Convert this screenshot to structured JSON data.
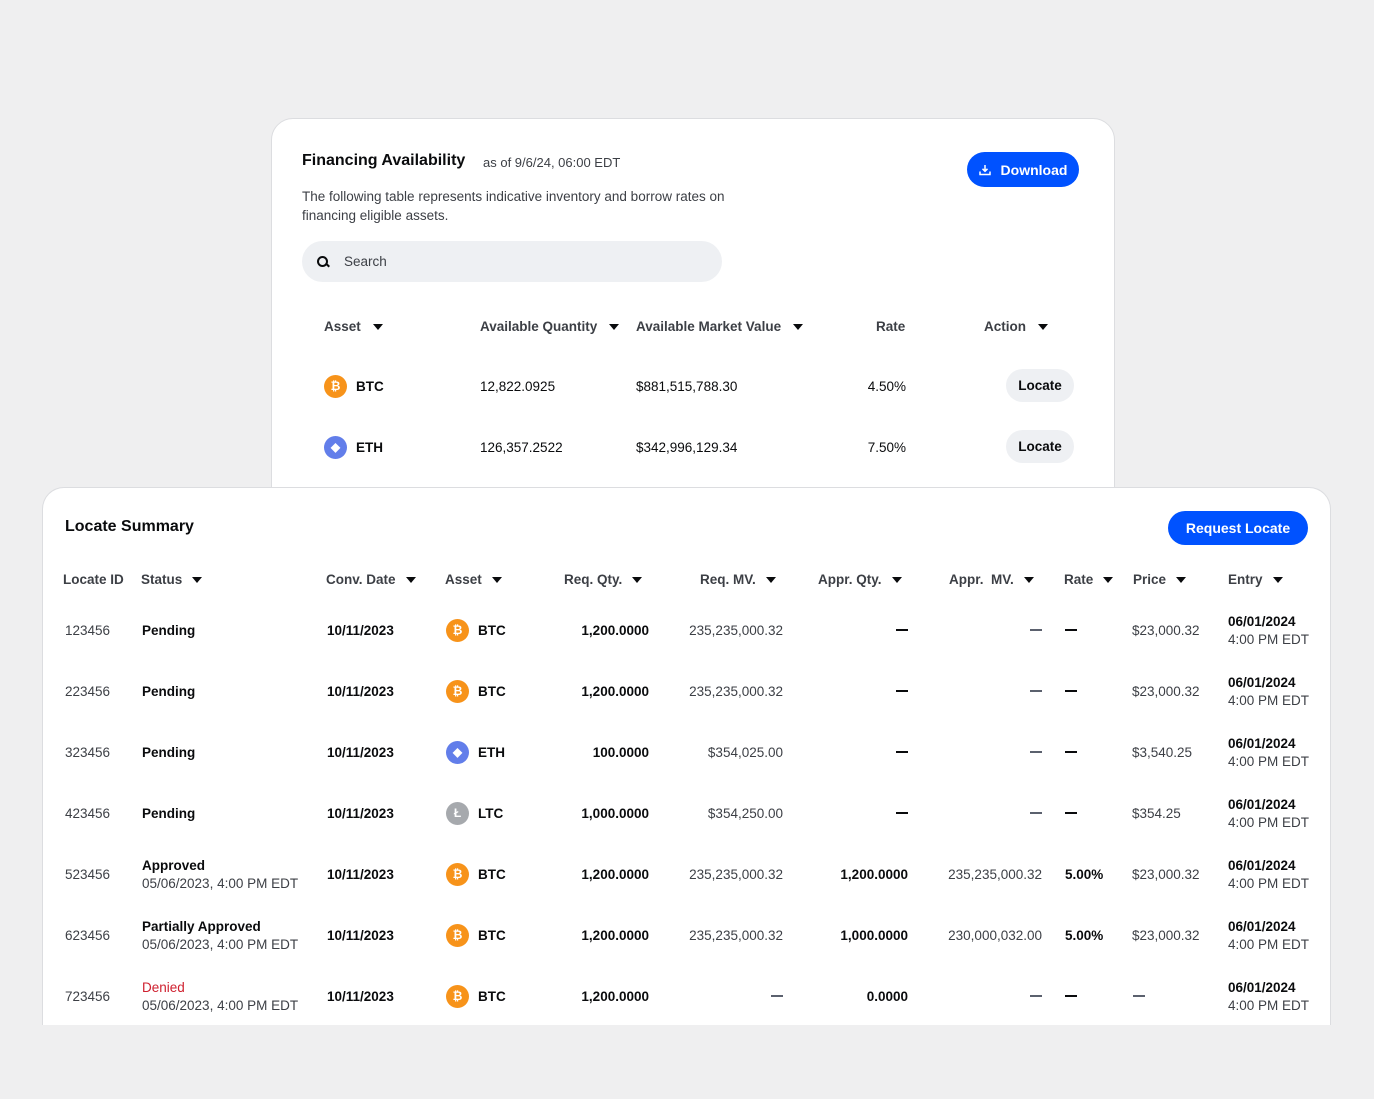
{
  "financing": {
    "title": "Financing Availability",
    "as_of": "as of 9/6/24, 06:00 EDT",
    "description": "The following table represents indicative inventory and borrow rates on financing eligible assets.",
    "download_label": "Download",
    "search_placeholder": "Search",
    "headers": {
      "asset": "Asset",
      "available_quantity": "Available Quantity",
      "available_market_value": "Available Market Value",
      "rate": "Rate",
      "action": "Action"
    },
    "rows": [
      {
        "coin": "btc",
        "icon": "bitcoin-icon",
        "symbol": "BTC",
        "quantity": "12,822.0925",
        "market_value": "$881,515,788.30",
        "rate": "4.50%",
        "action": "Locate"
      },
      {
        "coin": "eth",
        "icon": "ethereum-icon",
        "symbol": "ETH",
        "quantity": "126,357.2522",
        "market_value": "$342,996,129.34",
        "rate": "7.50%",
        "action": "Locate"
      }
    ]
  },
  "locate_summary": {
    "title": "Locate Summary",
    "request_label": "Request Locate",
    "headers": {
      "locate_id": "Locate ID",
      "status": "Status",
      "conv_date": "Conv. Date",
      "asset": "Asset",
      "req_qty": "Req. Qty.",
      "req_mv": "Req. MV.",
      "appr_qty": "Appr. Qty.",
      "appr_mv": "Appr.  MV.",
      "rate": "Rate",
      "price": "Price",
      "entry": "Entry"
    },
    "rows": [
      {
        "id": "123456",
        "status": "Pending",
        "status_sub": "",
        "conv_date": "10/11/2023",
        "coin": "btc",
        "icon": "bitcoin-icon",
        "symbol": "BTC",
        "req_qty": "1,200.0000",
        "req_mv": "235,235,000.32",
        "appr_qty": "—",
        "appr_mv": "—",
        "rate": "—",
        "price": "$23,000.32",
        "entry_date": "06/01/2024",
        "entry_time": "4:00 PM EDT"
      },
      {
        "id": "223456",
        "status": "Pending",
        "status_sub": "",
        "conv_date": "10/11/2023",
        "coin": "btc",
        "icon": "bitcoin-icon",
        "symbol": "BTC",
        "req_qty": "1,200.0000",
        "req_mv": "235,235,000.32",
        "appr_qty": "—",
        "appr_mv": "—",
        "rate": "—",
        "price": "$23,000.32",
        "entry_date": "06/01/2024",
        "entry_time": "4:00 PM EDT"
      },
      {
        "id": "323456",
        "status": "Pending",
        "status_sub": "",
        "conv_date": "10/11/2023",
        "coin": "eth",
        "icon": "ethereum-icon",
        "symbol": "ETH",
        "req_qty": "100.0000",
        "req_mv": "$354,025.00",
        "appr_qty": "—",
        "appr_mv": "—",
        "rate": "—",
        "price": "$3,540.25",
        "entry_date": "06/01/2024",
        "entry_time": "4:00 PM EDT"
      },
      {
        "id": "423456",
        "status": "Pending",
        "status_sub": "",
        "conv_date": "10/11/2023",
        "coin": "ltc",
        "icon": "litecoin-icon",
        "symbol": "LTC",
        "req_qty": "1,000.0000",
        "req_mv": "$354,250.00",
        "appr_qty": "—",
        "appr_mv": "—",
        "rate": "—",
        "price": "$354.25",
        "entry_date": "06/01/2024",
        "entry_time": "4:00 PM EDT"
      },
      {
        "id": "523456",
        "status": "Approved",
        "status_sub": "05/06/2023, 4:00 PM EDT",
        "conv_date": "10/11/2023",
        "coin": "btc",
        "icon": "bitcoin-icon",
        "symbol": "BTC",
        "req_qty": "1,200.0000",
        "req_mv": "235,235,000.32",
        "appr_qty": "1,200.0000",
        "appr_mv": "235,235,000.32",
        "rate": "5.00%",
        "price": "$23,000.32",
        "entry_date": "06/01/2024",
        "entry_time": "4:00 PM EDT"
      },
      {
        "id": "623456",
        "status": "Partially Approved",
        "status_sub": "05/06/2023, 4:00 PM EDT",
        "conv_date": "10/11/2023",
        "coin": "btc",
        "icon": "bitcoin-icon",
        "symbol": "BTC",
        "req_qty": "1,200.0000",
        "req_mv": "235,235,000.32",
        "appr_qty": "1,000.0000",
        "appr_mv": "230,000,032.00",
        "rate": "5.00%",
        "price": "$23,000.32",
        "entry_date": "06/01/2024",
        "entry_time": "4:00 PM EDT"
      },
      {
        "id": "723456",
        "status": "Denied",
        "status_sub": "05/06/2023, 4:00 PM EDT",
        "conv_date": "10/11/2023",
        "coin": "btc",
        "icon": "bitcoin-icon",
        "symbol": "BTC",
        "req_qty": "1,200.0000",
        "req_mv": "—",
        "appr_qty": "0.0000",
        "appr_mv": "—",
        "rate": "—",
        "price": "—",
        "entry_date": "06/01/2024",
        "entry_time": "4:00 PM EDT"
      }
    ]
  },
  "colors": {
    "accent": "#0052ff",
    "btc": "#f7931a",
    "eth": "#627eea",
    "ltc": "#a6a9ad",
    "denied": "#cf202f"
  }
}
